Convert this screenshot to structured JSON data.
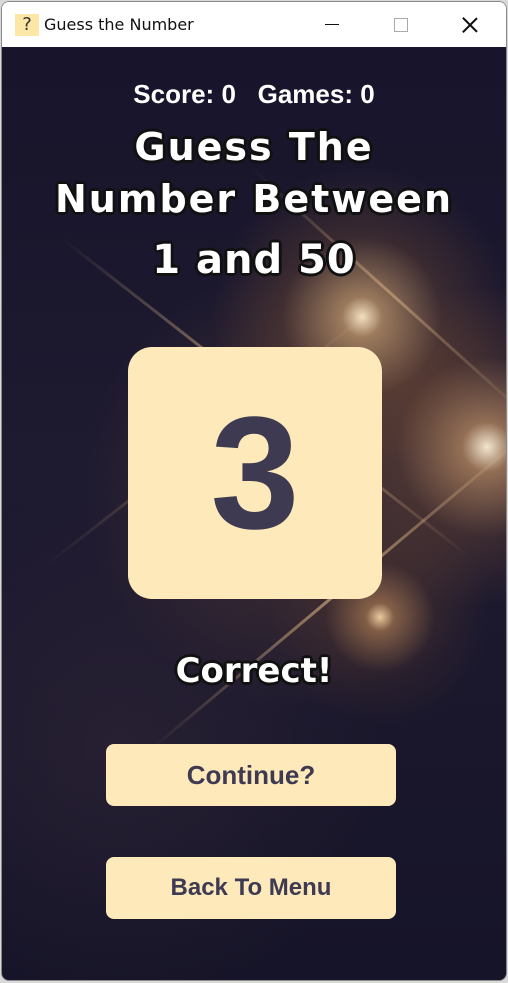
{
  "window": {
    "title": "Guess the Number",
    "icon_glyph": "?",
    "icon": "question-mark-icon",
    "controls": [
      "minimize-icon",
      "maximize-icon",
      "close-icon"
    ]
  },
  "stats": {
    "score_label": "Score:",
    "score": "0",
    "games_label": "Games:",
    "games": "0"
  },
  "heading": {
    "line1": "Guess The",
    "line2": "Number Between",
    "line3": "1 and 50"
  },
  "guess": {
    "number": "3"
  },
  "result": {
    "text": "Correct!"
  },
  "buttons": {
    "continue_label": "Continue?",
    "menu_label": "Back To Menu"
  },
  "colors": {
    "card": "#fde9b9",
    "card_text": "#3d3a52",
    "background": "#17152a",
    "title_text": "#ffffff",
    "outline": "#111111"
  }
}
